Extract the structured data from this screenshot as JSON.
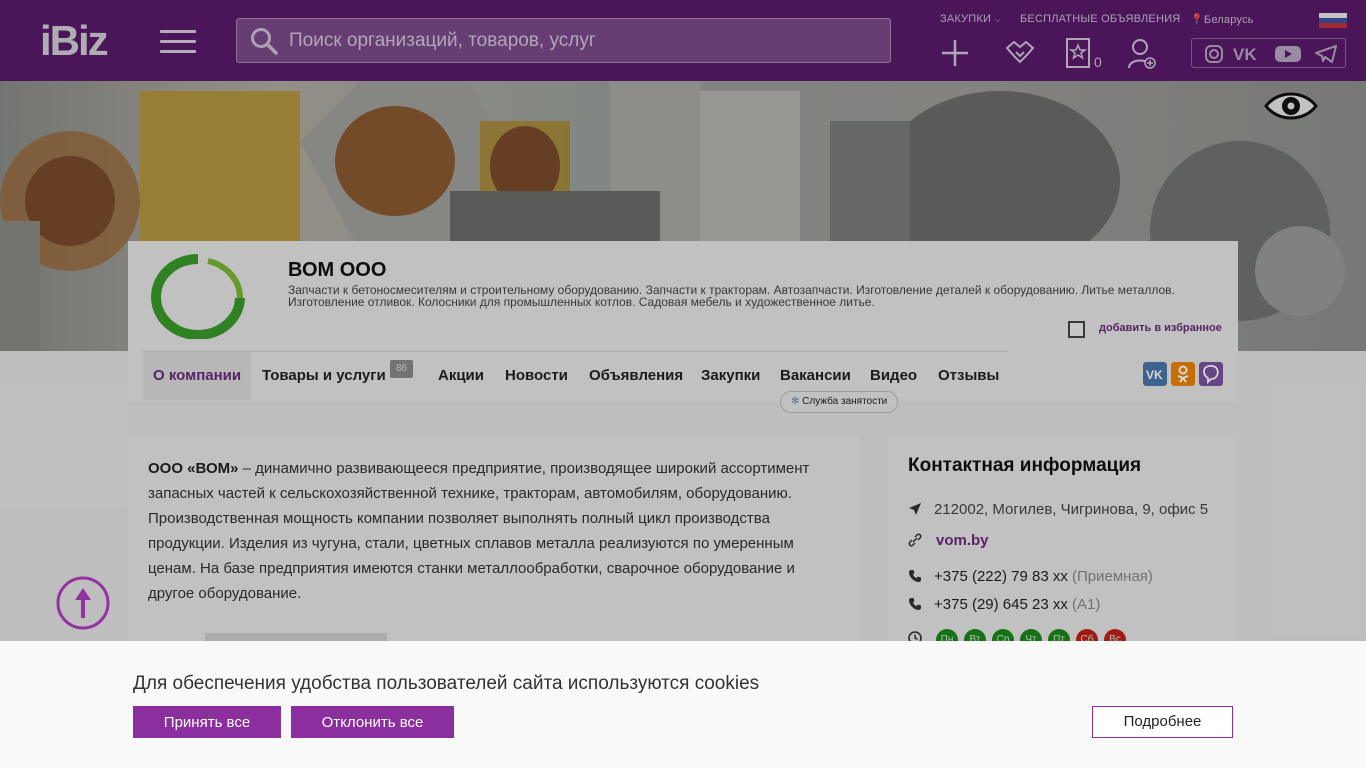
{
  "header": {
    "logo": "iBiz",
    "search_placeholder": "Поиск организаций, товаров, услуг",
    "link_purchases": "ЗАКУПКИ",
    "link_free_ads": "БЕСПЛАТНЫЕ ОБЪЯВЛЕНИЯ",
    "region": "Беларусь",
    "favorites_count": "0"
  },
  "company": {
    "name": "ВОМ ООО",
    "description": "Запчасти к бетоносмесителям и строительному оборудованию. Запчасти к тракторам. Автозапчасти. Изготовление деталей к оборудованию. Литье металлов. Изготовление отливок. Колосники для промышленных котлов. Садовая мебель и художественное литье.",
    "add_favorite": "добавить в избранное"
  },
  "tabs": [
    {
      "label": "О компании"
    },
    {
      "label": "Товары и услуги",
      "badge": "86"
    },
    {
      "label": "Акции"
    },
    {
      "label": "Новости"
    },
    {
      "label": "Объявления"
    },
    {
      "label": "Закупки"
    },
    {
      "label": "Вакансии"
    },
    {
      "label": "Видео"
    },
    {
      "label": "Отзывы"
    }
  ],
  "employment_pill": "Служба занятости",
  "about": {
    "company_bold": "ООО «ВОМ»",
    "text": " – динамично развивающееся предприятие, производящее широкий ассортимент запасных частей к сельскохозяйственной технике, тракторам, автомобилям, оборудованию. Производственная мощность компании позволяет выполнять полный цикл производства продукции. Изделия из чугуна, стали, цветных сплавов металла реализуются по умеренным ценам.  На базе предприятия имеются станки металлообработки, сварочное оборудование и другое оборудование."
  },
  "contact": {
    "title": "Контактная информация",
    "address": "212002, Могилев, Чигринова, 9, офис 5",
    "website": "vom.by",
    "phone1": "+375 (222) 79 83 xx",
    "phone1_note": "(Приемная)",
    "phone2": "+375 (29) 645 23 xx",
    "phone2_note": "(А1)",
    "days": [
      "Пн",
      "Вт",
      "Ср",
      "Чт",
      "Пт",
      "Сб",
      "Вс"
    ]
  },
  "cookie": {
    "message": "Для обеспечения удобства пользователей сайта используются cookies",
    "accept": "Принять все",
    "decline": "Отклонить все",
    "more": "Подробнее"
  },
  "colors": {
    "header_bg": "#5a1a6b",
    "accent": "#8b2f9e",
    "open_day": "#1a8a1a",
    "closed_day": "#c0201a"
  }
}
